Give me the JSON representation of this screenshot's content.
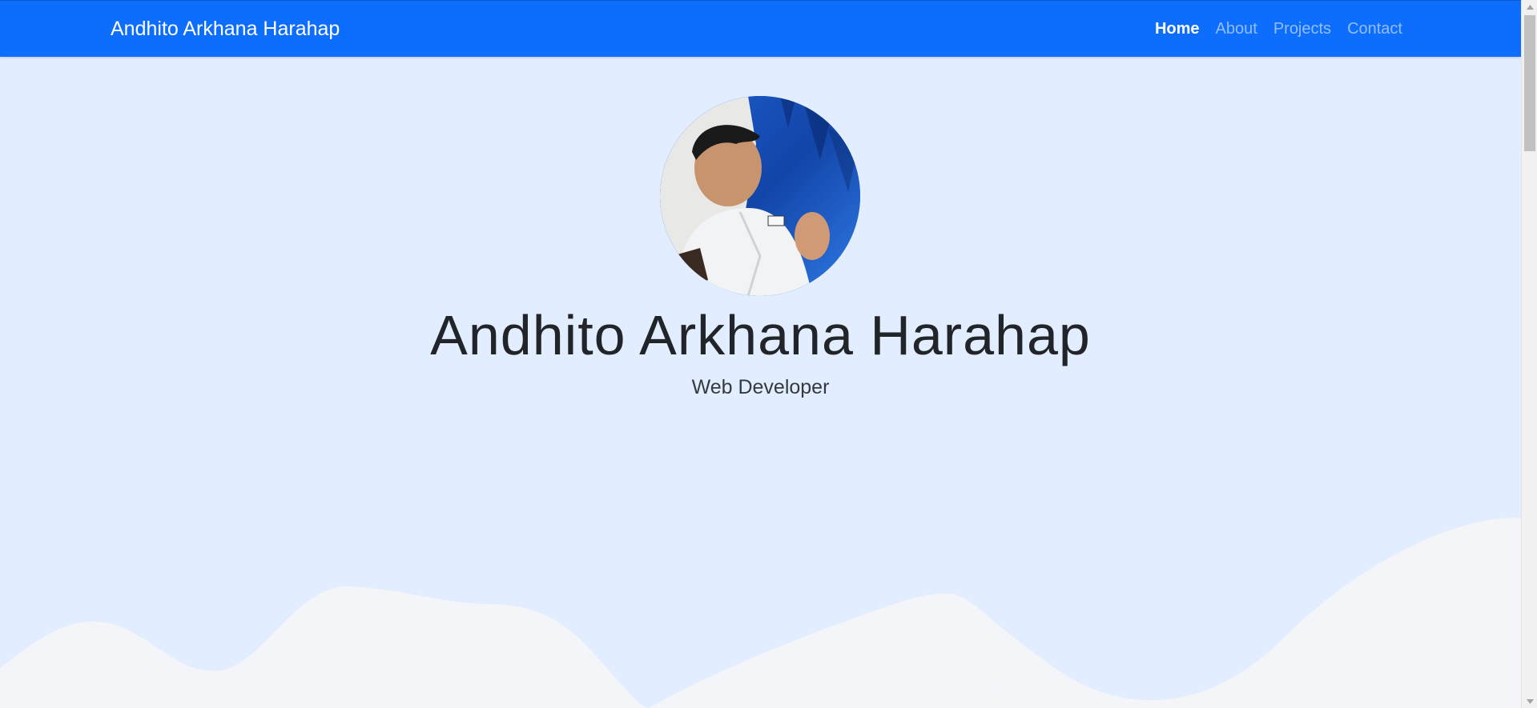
{
  "navbar": {
    "brand": "Andhito Arkhana Harahap",
    "links": [
      {
        "label": "Home",
        "active": true
      },
      {
        "label": "About",
        "active": false
      },
      {
        "label": "Projects",
        "active": false
      },
      {
        "label": "Contact",
        "active": false
      }
    ]
  },
  "hero": {
    "title": "Andhito Arkhana Harahap",
    "subtitle": "Web Developer",
    "avatar_icon": "profile-photo"
  },
  "colors": {
    "navbar": "#0d6efd",
    "background": "#e2edff",
    "wave": "#f3f5f8",
    "title": "#212529"
  }
}
